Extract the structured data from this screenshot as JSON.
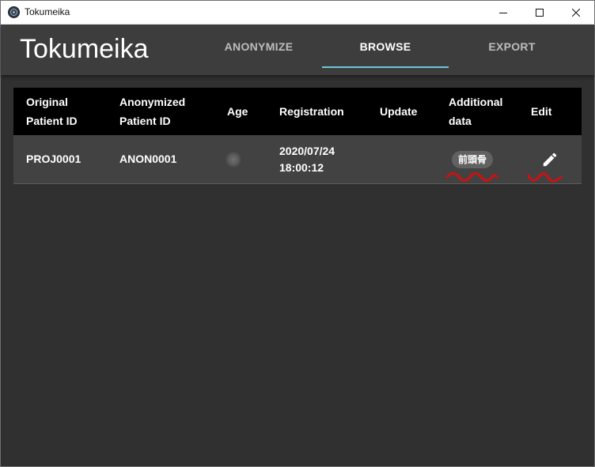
{
  "window": {
    "title": "Tokumeika"
  },
  "app": {
    "brand": "Tokumeika",
    "tabs": [
      {
        "label": "ANONYMIZE",
        "active": false
      },
      {
        "label": "BROWSE",
        "active": true
      },
      {
        "label": "EXPORT",
        "active": false
      }
    ],
    "accent_color": "#6fc7d8"
  },
  "table": {
    "headers": {
      "original_id": [
        "Original",
        "Patient ID"
      ],
      "anonymized_id": [
        "Anonymized",
        "Patient ID"
      ],
      "age": "Age",
      "registration": "Registration",
      "update": "Update",
      "additional": [
        "Additional",
        "data"
      ],
      "edit": "Edit"
    },
    "rows": [
      {
        "original_id": "PROJ0001",
        "anonymized_id": "ANON0001",
        "registration_date": "2020/07/24",
        "registration_time": "18:00:12",
        "update": "",
        "additional_tag": "前頭骨",
        "edit_icon": "pencil-icon"
      }
    ]
  },
  "annotations": {
    "color": "#cc1111"
  }
}
